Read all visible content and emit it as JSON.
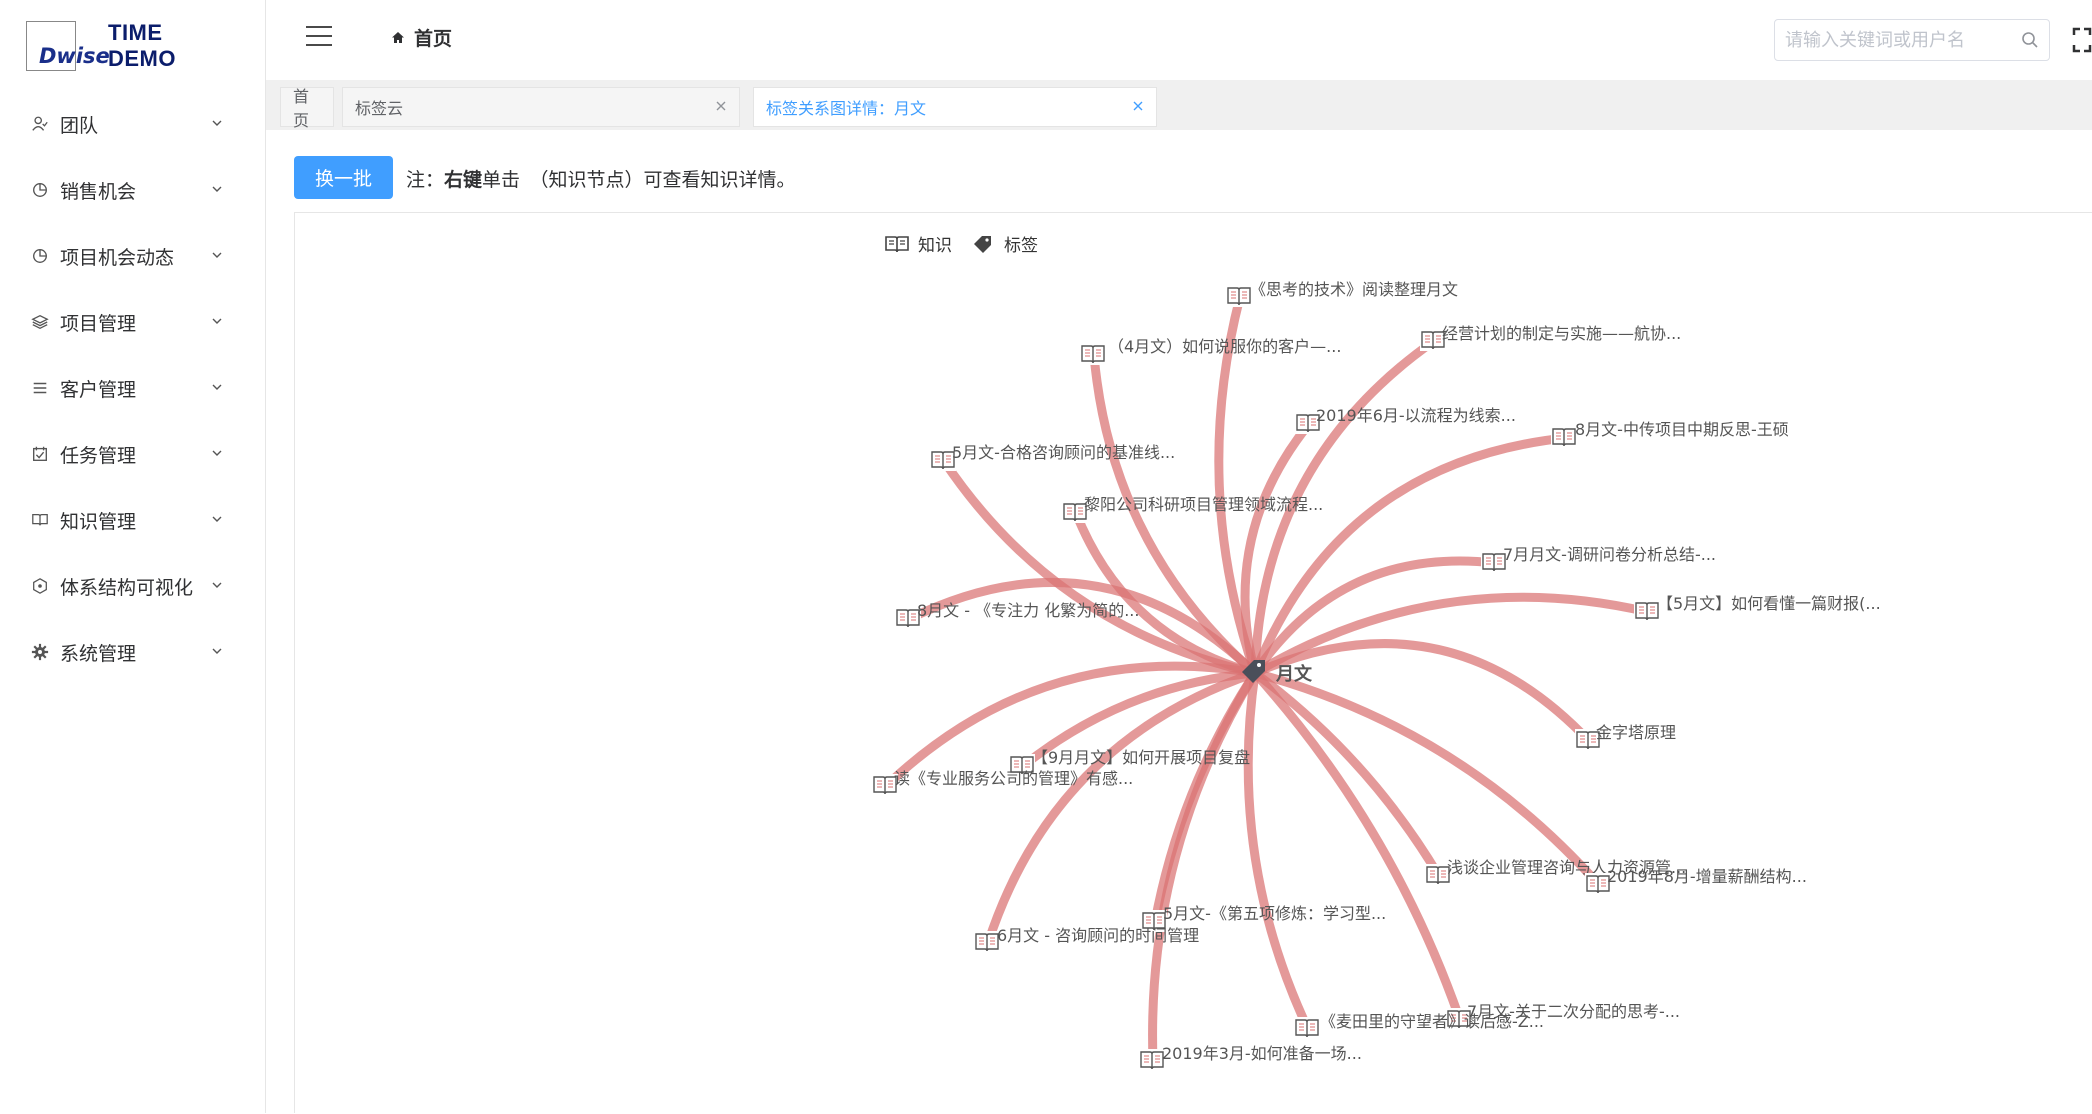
{
  "app": {
    "logo_mark": "Dwise",
    "title": "TIME DEMO"
  },
  "sidebar": {
    "items": [
      {
        "label": "团队",
        "icon": "team-icon"
      },
      {
        "label": "销售机会",
        "icon": "pie-chart-icon"
      },
      {
        "label": "项目机会动态",
        "icon": "pie-chart-icon"
      },
      {
        "label": "项目管理",
        "icon": "layers-icon"
      },
      {
        "label": "客户管理",
        "icon": "list-icon"
      },
      {
        "label": "任务管理",
        "icon": "calendar-check-icon"
      },
      {
        "label": "知识管理",
        "icon": "book-icon"
      },
      {
        "label": "体系结构可视化",
        "icon": "hexagon-network-icon"
      },
      {
        "label": "系统管理",
        "icon": "gear-icon"
      }
    ]
  },
  "header": {
    "breadcrumb": "首页",
    "search_placeholder": "请输入关键词或用户名"
  },
  "tabs": [
    {
      "label": "首页",
      "active": false,
      "closable": false
    },
    {
      "label": "标签云",
      "active": false,
      "closable": true
    },
    {
      "label": "标签关系图详情：月文",
      "active": true,
      "closable": true
    }
  ],
  "toolbar": {
    "refresh_label": "换一批",
    "note_prefix": "注：",
    "note_bold": "右键",
    "note_rest": "单击　（知识节点）可查看知识详情。"
  },
  "legend": {
    "knowledge": "知识",
    "tag": "标签"
  },
  "graph": {
    "center": {
      "label": "月文"
    },
    "colors": {
      "edge": "#d97272",
      "icon": "#555555"
    },
    "nodes": [
      {
        "label": "《思考的技术》阅读整理月文"
      },
      {
        "label": "经营计划的制定与实施——航协..."
      },
      {
        "label": "（4月文）如何说服你的客户—..."
      },
      {
        "label": "2019年6月-以流程为线索..."
      },
      {
        "label": "8月文-中传项目中期反思-王硕"
      },
      {
        "label": "5月文-合格咨询顾问的基准线..."
      },
      {
        "label": "黎阳公司科研项目管理领域流程..."
      },
      {
        "label": "7月月文-调研问卷分析总结-..."
      },
      {
        "label": "【5月文】如何看懂一篇财报(..."
      },
      {
        "label": "8月文 - 《专注力 化繁为简的..."
      },
      {
        "label": "金字塔原理"
      },
      {
        "label": "【9月月文】如何开展项目复盘"
      },
      {
        "label": "读《专业服务公司的管理》有感..."
      },
      {
        "label": "浅谈企业管理咨询与人力资源管..."
      },
      {
        "label": "2019年8月-增量薪酬结构..."
      },
      {
        "label": "5月文-《第五项修炼：学习型..."
      },
      {
        "label": "6月文 - 咨询顾问的时间管理"
      },
      {
        "label": "7月文-关于二次分配的思考-..."
      },
      {
        "label": "《麦田里的守望者》读后感-Z..."
      },
      {
        "label": "2019年3月-如何准备一场..."
      }
    ]
  }
}
